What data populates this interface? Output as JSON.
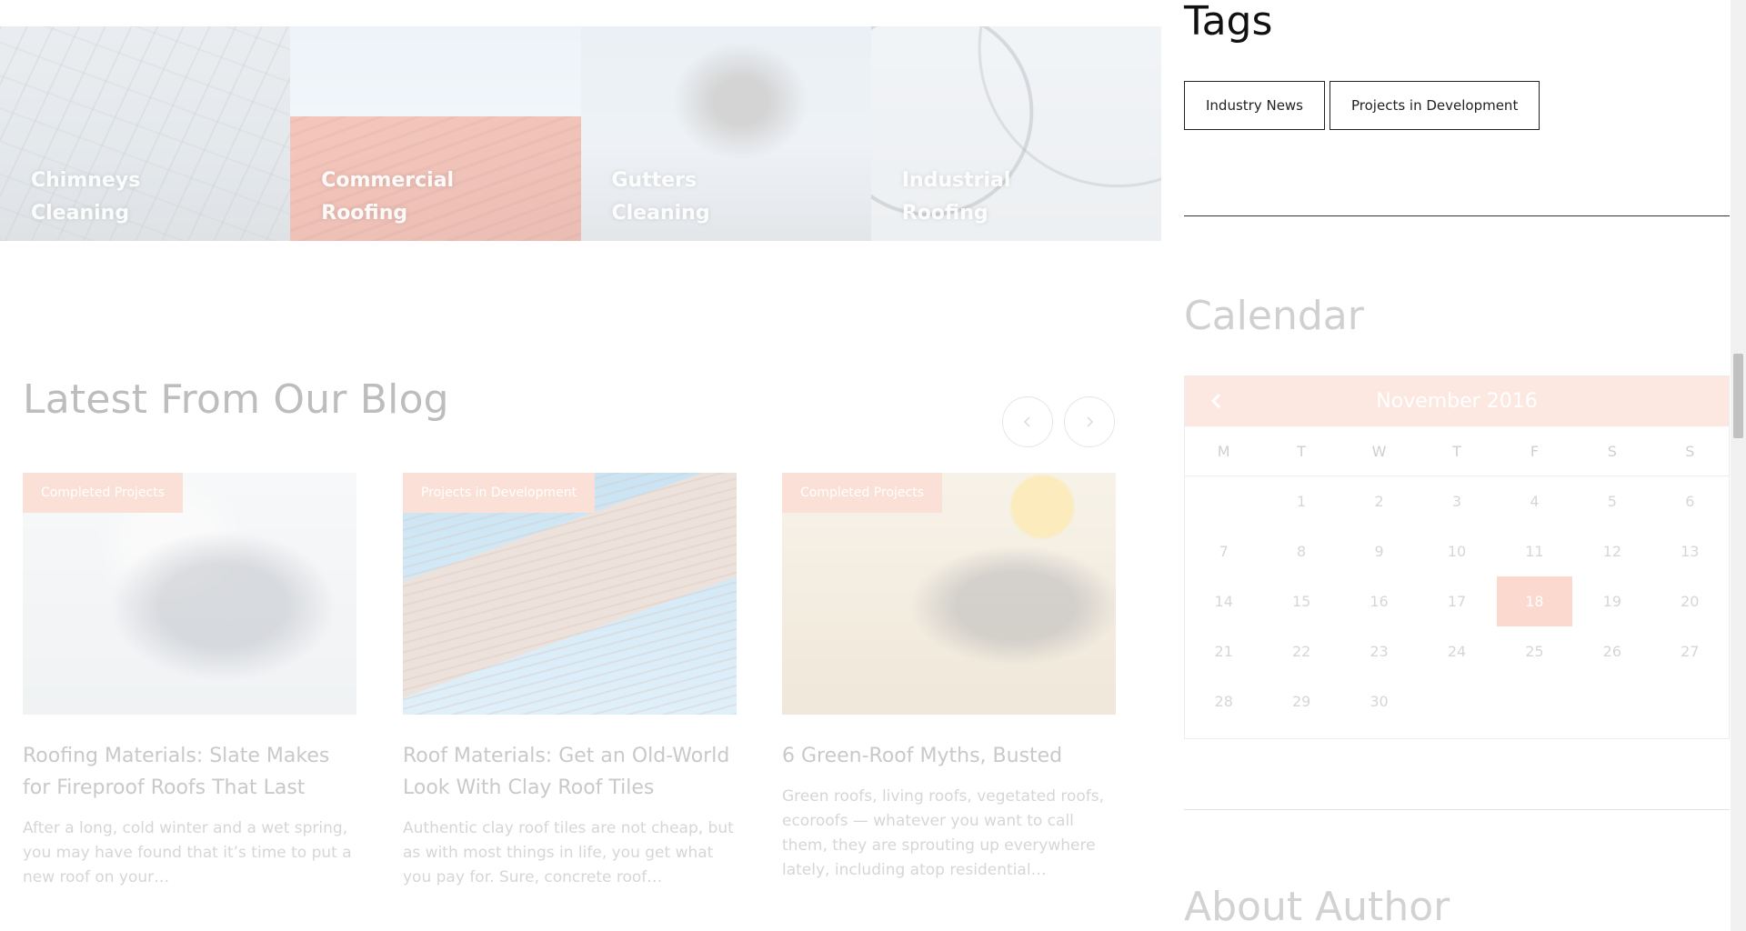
{
  "services": [
    {
      "label": "Chimneys Cleaning",
      "line1": "Chimneys",
      "line2": "Cleaning"
    },
    {
      "label": "Commercial Roofing",
      "line1": "Commercial",
      "line2": "Roofing"
    },
    {
      "label": "Gutters Cleaning",
      "line1": "Gutters",
      "line2": "Cleaning"
    },
    {
      "label": "Industrial Roofing",
      "line1": "Industrial",
      "line2": "Roofing"
    }
  ],
  "blog": {
    "heading": "Latest From Our Blog",
    "prev_icon": "chevron-left-icon",
    "next_icon": "chevron-right-icon",
    "posts": [
      {
        "badge": "Completed Projects",
        "title": "Roofing Materials: Slate Makes for Fireproof Roofs That Last",
        "excerpt": "After a long, cold winter and a wet spring, you may have found that it’s time to put a new roof on your…"
      },
      {
        "badge": "Projects in Development",
        "title": "Roof Materials: Get an Old-World Look With Clay Roof Tiles",
        "excerpt": "Authentic clay roof tiles are not cheap, but as with most things in life, you get what you pay for. Sure, concrete roof…"
      },
      {
        "badge": "Completed Projects",
        "title": "6 Green-Roof Myths, Busted",
        "excerpt": "Green roofs, living roofs, vegetated roofs, ecoroofs — whatever you want to call them, they are sprouting up everywhere lately, including atop residential…"
      }
    ]
  },
  "sidebar": {
    "tags": {
      "title": "Tags",
      "items": [
        "Industry News",
        "Projects in Development"
      ]
    },
    "calendar": {
      "title": "Calendar",
      "month": "November 2016",
      "prev_icon": "chevron-left-icon",
      "weekdays": [
        "M",
        "T",
        "W",
        "T",
        "F",
        "S",
        "S"
      ],
      "weeks": [
        [
          "",
          "1",
          "2",
          "3",
          "4",
          "5",
          "6"
        ],
        [
          "7",
          "8",
          "9",
          "10",
          "11",
          "12",
          "13"
        ],
        [
          "14",
          "15",
          "16",
          "17",
          "18",
          "19",
          "20"
        ],
        [
          "21",
          "22",
          "23",
          "24",
          "25",
          "26",
          "27"
        ],
        [
          "28",
          "29",
          "30",
          "",
          "",
          "",
          ""
        ]
      ],
      "highlighted_day": "18"
    },
    "about": {
      "title": "About Author"
    }
  },
  "colors": {
    "accent": "#fbd9cf",
    "accent_header": "#fde8e1",
    "text_dark": "#111111"
  }
}
